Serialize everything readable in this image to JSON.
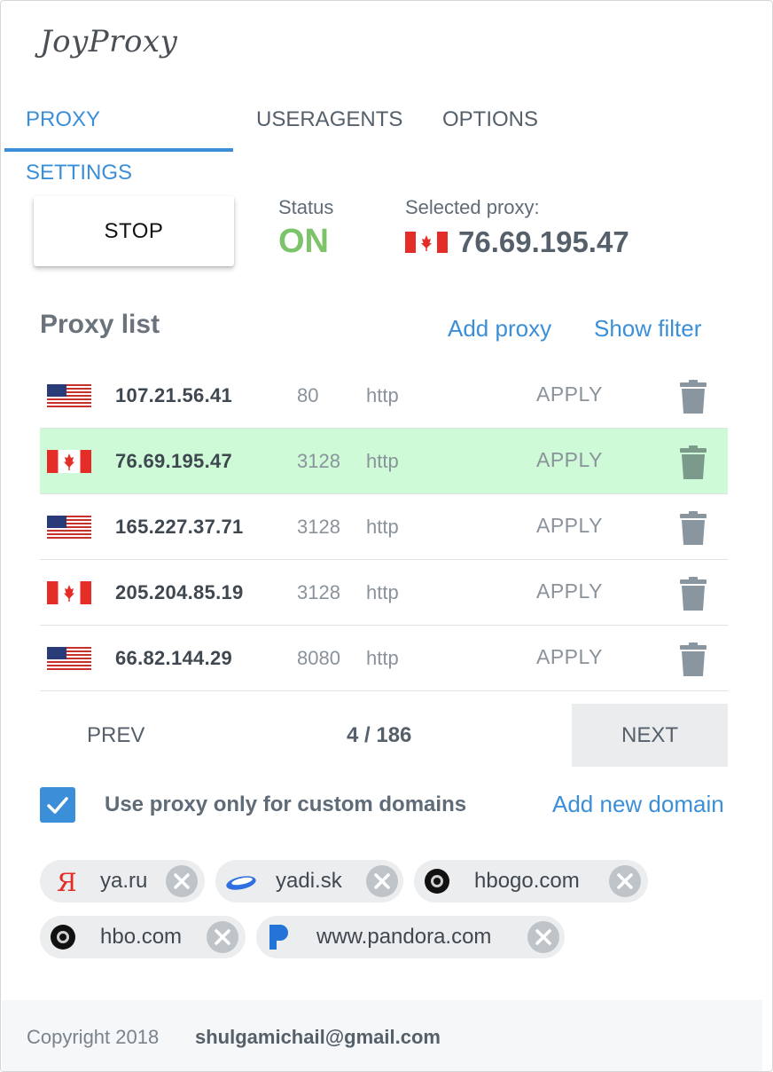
{
  "app": {
    "title": "JoyProxy"
  },
  "tabs": [
    {
      "label": "PROXY SETTINGS",
      "active": true
    },
    {
      "label": "USERAGENTS",
      "active": false
    },
    {
      "label": "OPTIONS",
      "active": false
    }
  ],
  "control": {
    "stop_label": "STOP",
    "status_label": "Status",
    "status_value": "ON",
    "selected_label": "Selected proxy:",
    "selected_flag": "canada-flag-icon",
    "selected_ip": "76.69.195.47"
  },
  "proxy_list": {
    "title": "Proxy list",
    "add_label": "Add proxy",
    "filter_label": "Show filter",
    "rows": [
      {
        "flag": "usa-flag-icon",
        "ip": "107.21.56.41",
        "port": "80",
        "protocol": "http",
        "action": "APPLY",
        "selected": false
      },
      {
        "flag": "canada-flag-icon",
        "ip": "76.69.195.47",
        "port": "3128",
        "protocol": "http",
        "action": "APPLY",
        "selected": true
      },
      {
        "flag": "usa-flag-icon",
        "ip": "165.227.37.71",
        "port": "3128",
        "protocol": "http",
        "action": "APPLY",
        "selected": false
      },
      {
        "flag": "canada-flag-icon",
        "ip": "205.204.85.19",
        "port": "3128",
        "protocol": "http",
        "action": "APPLY",
        "selected": false
      },
      {
        "flag": "usa-flag-icon",
        "ip": "66.82.144.29",
        "port": "8080",
        "protocol": "http",
        "action": "APPLY",
        "selected": false
      }
    ]
  },
  "pagination": {
    "prev_label": "PREV",
    "page_text": "4 / 186",
    "next_label": "NEXT"
  },
  "custom_domains": {
    "checkbox_checked": true,
    "checkbox_label": "Use proxy only for custom domains",
    "add_label": "Add new domain",
    "chips": [
      {
        "icon": "yandex-icon",
        "label": "ya.ru"
      },
      {
        "icon": "yadi-cloud-icon",
        "label": "yadi.sk"
      },
      {
        "icon": "hbo-icon",
        "label": "hbogo.com"
      },
      {
        "icon": "hbo-icon",
        "label": "hbo.com"
      },
      {
        "icon": "pandora-icon",
        "label": "www.pandora.com"
      }
    ]
  },
  "footer": {
    "copyright": "Copyright 2018",
    "email": "shulgamichail@gmail.com"
  },
  "colors": {
    "accent": "#3b8fd8",
    "status_on": "#7cc36a",
    "selected_row": "#cefad8"
  }
}
